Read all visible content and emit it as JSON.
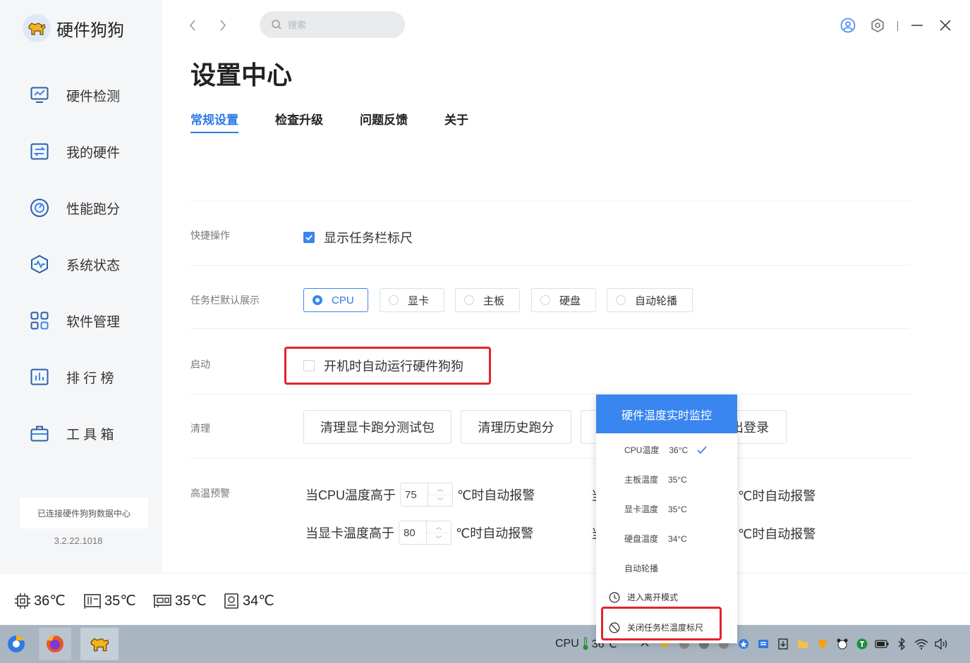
{
  "app": {
    "name": "硬件狗狗"
  },
  "nav": {
    "items": [
      {
        "label": "硬件检测"
      },
      {
        "label": "我的硬件"
      },
      {
        "label": "性能跑分"
      },
      {
        "label": "系统状态"
      },
      {
        "label": "软件管理"
      },
      {
        "label": "排 行 榜"
      },
      {
        "label": "工 具 箱"
      }
    ]
  },
  "sidebar_footer": {
    "connection": "已连接硬件狗狗数据中心",
    "version": "3.2.22.1018"
  },
  "search": {
    "placeholder": "搜索"
  },
  "page": {
    "title": "设置中心"
  },
  "tabs": [
    {
      "label": "常规设置",
      "active": true
    },
    {
      "label": "检查升级"
    },
    {
      "label": "问题反馈"
    },
    {
      "label": "关于"
    }
  ],
  "settings": {
    "quick": {
      "label": "快捷操作",
      "option": "显示任务栏标尺",
      "checked": true
    },
    "taskbar_default": {
      "label": "任务栏默认展示",
      "options": [
        "CPU",
        "显卡",
        "主板",
        "硬盘",
        "自动轮播"
      ],
      "selected": "CPU"
    },
    "startup": {
      "label": "启动",
      "option": "开机时自动运行硬件狗狗",
      "checked": false
    },
    "clean": {
      "label": "清理",
      "buttons": [
        "清理显卡跑分测试包",
        "清理历史跑分",
        "出登录"
      ]
    },
    "alarm": {
      "label": "高温预警",
      "cpu_prefix": "当CPU温度高于",
      "cpu_value": "75",
      "gpu_prefix": "当显卡温度高于",
      "gpu_value": "80",
      "suffix": "℃时自动报警",
      "right_prefix": "当",
      "right_suffix": "℃时自动报警"
    }
  },
  "bottom_temps": [
    "36℃",
    "35℃",
    "35℃",
    "34℃"
  ],
  "popup": {
    "title": "硬件温度实时监控",
    "items": [
      {
        "label": "CPU温度",
        "value": "36°C",
        "checked": true
      },
      {
        "label": "主板温度",
        "value": "35°C"
      },
      {
        "label": "显卡温度",
        "value": "35°C"
      },
      {
        "label": "硬盘温度",
        "value": "34°C"
      },
      {
        "label": "自动轮播",
        "value": ""
      }
    ],
    "away_mode": "进入离开模式",
    "close_ruler": "关闭任务栏温度标尺"
  },
  "taskbar": {
    "cpu_label": "CPU",
    "cpu_temp": "36℃"
  },
  "colors": {
    "accent": "#3a86f0",
    "highlight": "#e3232c",
    "sidebar_bg": "#f5f6f8"
  }
}
